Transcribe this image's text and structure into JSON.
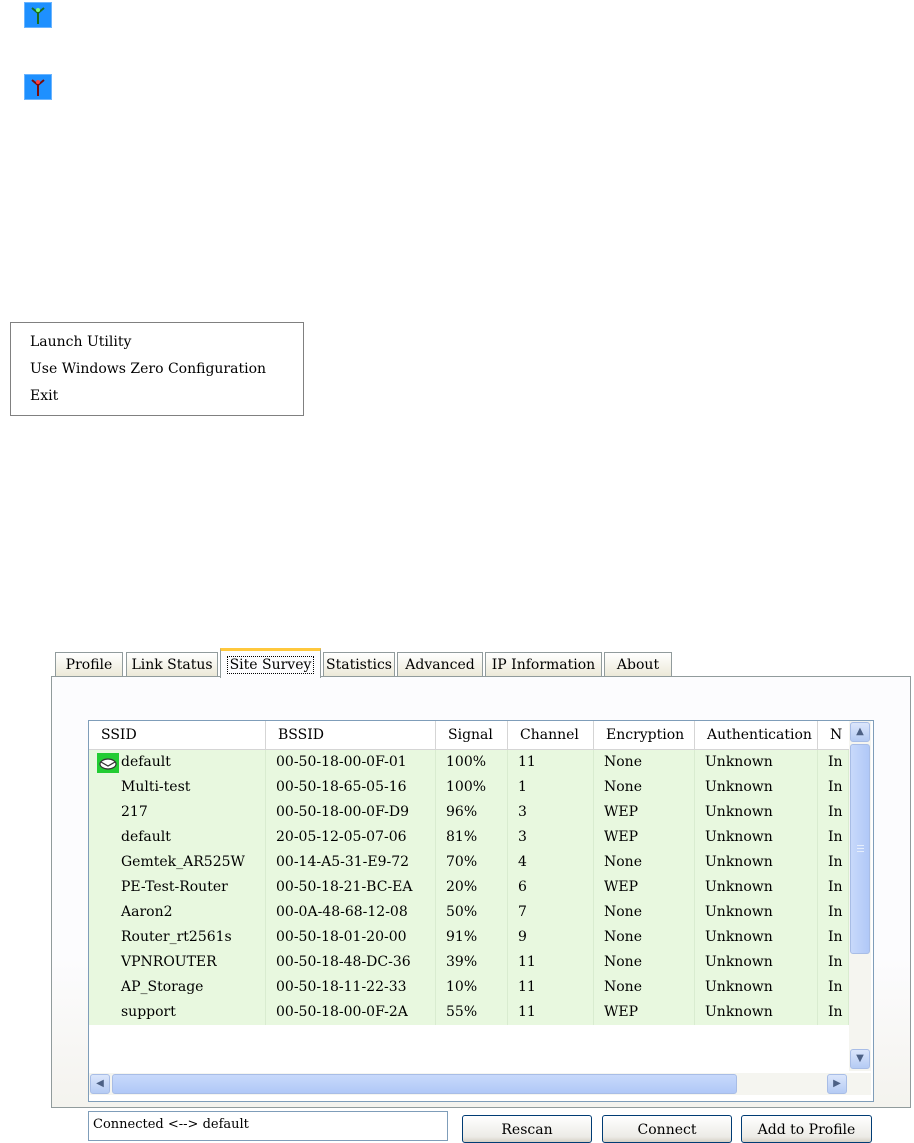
{
  "context_menu": {
    "items": [
      "Launch Utility",
      "Use Windows Zero Configuration",
      "Exit"
    ]
  },
  "tabs": [
    "Profile",
    "Link Status",
    "Site Survey",
    "Statistics",
    "Advanced",
    "IP Information",
    "About"
  ],
  "active_tab": "Site Survey",
  "columns": [
    "SSID",
    "BSSID",
    "Signal",
    "Channel",
    "Encryption",
    "Authentication",
    "N"
  ],
  "networks": [
    {
      "ssid": "default",
      "bssid": "00-50-18-00-0F-01",
      "signal": "100%",
      "channel": "11",
      "encryption": "None",
      "auth": "Unknown",
      "n": "In",
      "connected": true
    },
    {
      "ssid": "Multi-test",
      "bssid": "00-50-18-65-05-16",
      "signal": "100%",
      "channel": "1",
      "encryption": "None",
      "auth": "Unknown",
      "n": "In",
      "connected": false
    },
    {
      "ssid": "217",
      "bssid": "00-50-18-00-0F-D9",
      "signal": "96%",
      "channel": "3",
      "encryption": "WEP",
      "auth": "Unknown",
      "n": "In",
      "connected": false
    },
    {
      "ssid": "default",
      "bssid": "20-05-12-05-07-06",
      "signal": "81%",
      "channel": "3",
      "encryption": "WEP",
      "auth": "Unknown",
      "n": "In",
      "connected": false
    },
    {
      "ssid": "Gemtek_AR525W",
      "bssid": "00-14-A5-31-E9-72",
      "signal": "70%",
      "channel": "4",
      "encryption": "None",
      "auth": "Unknown",
      "n": "In",
      "connected": false
    },
    {
      "ssid": "PE-Test-Router",
      "bssid": "00-50-18-21-BC-EA",
      "signal": "20%",
      "channel": "6",
      "encryption": "WEP",
      "auth": "Unknown",
      "n": "In",
      "connected": false
    },
    {
      "ssid": "Aaron2",
      "bssid": "00-0A-48-68-12-08",
      "signal": "50%",
      "channel": "7",
      "encryption": "None",
      "auth": "Unknown",
      "n": "In",
      "connected": false
    },
    {
      "ssid": "Router_rt2561s",
      "bssid": "00-50-18-01-20-00",
      "signal": "91%",
      "channel": "9",
      "encryption": "None",
      "auth": "Unknown",
      "n": "In",
      "connected": false
    },
    {
      "ssid": "VPNROUTER",
      "bssid": "00-50-18-48-DC-36",
      "signal": "39%",
      "channel": "11",
      "encryption": "None",
      "auth": "Unknown",
      "n": "In",
      "connected": false
    },
    {
      "ssid": "AP_Storage",
      "bssid": "00-50-18-11-22-33",
      "signal": "10%",
      "channel": "11",
      "encryption": "None",
      "auth": "Unknown",
      "n": "In",
      "connected": false
    },
    {
      "ssid": "support",
      "bssid": "00-50-18-00-0F-2A",
      "signal": "55%",
      "channel": "11",
      "encryption": "WEP",
      "auth": "Unknown",
      "n": "In",
      "connected": false
    }
  ],
  "status_text": "Connected <--> default",
  "buttons": {
    "rescan": "Rescan",
    "connect": "Connect",
    "add_profile": "Add to Profile"
  },
  "colors": {
    "list_bg": "#e8f8df",
    "tray_bg": "#1e90ff",
    "tab_highlight": "#ffc83c",
    "connected_icon": "#22cc33"
  }
}
